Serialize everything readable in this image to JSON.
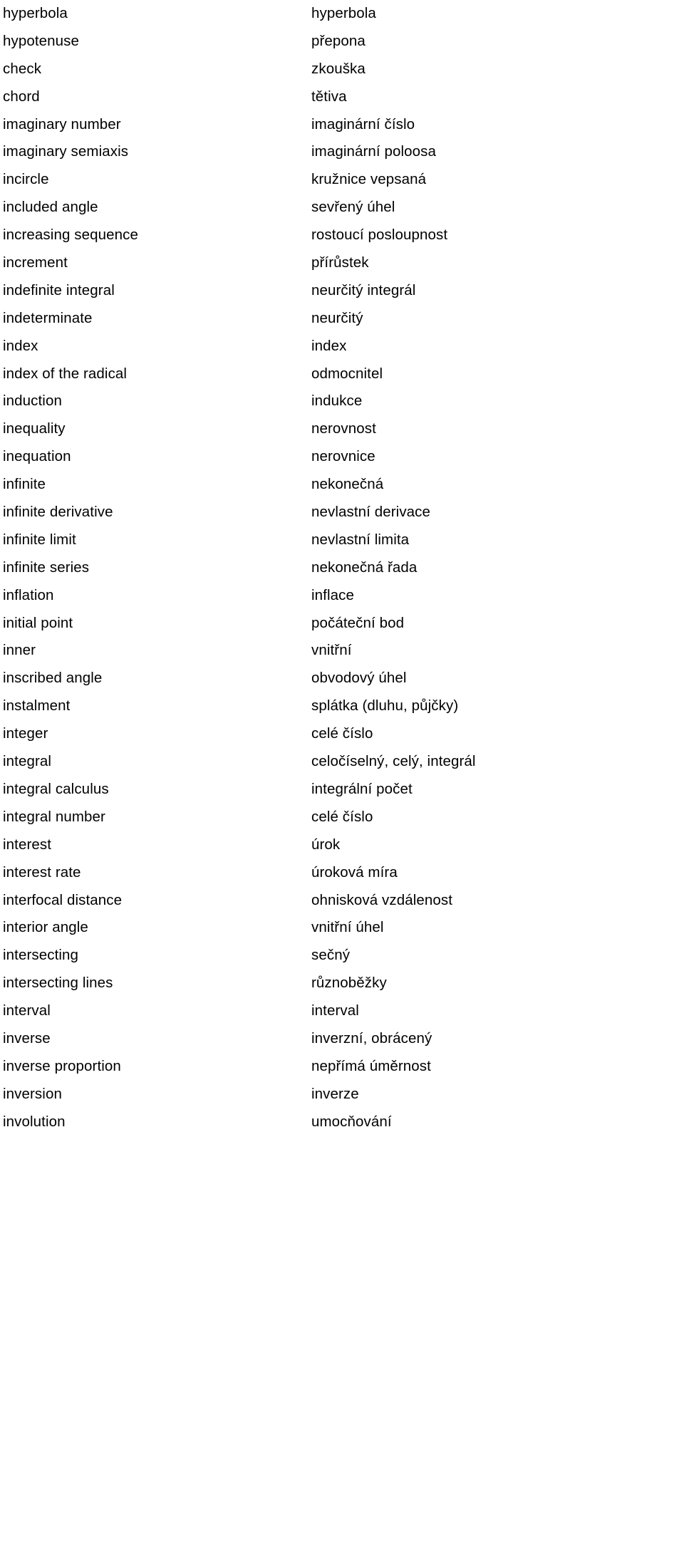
{
  "document": {
    "type": "bilingual-glossary",
    "source_language": "English",
    "target_language": "Czech",
    "columns": [
      "term",
      "translation"
    ],
    "entries": [
      {
        "term": "hyperbola",
        "translation": "hyperbola"
      },
      {
        "term": "hypotenuse",
        "translation": "přepona"
      },
      {
        "term": "check",
        "translation": "zkouška"
      },
      {
        "term": "chord",
        "translation": "tětiva"
      },
      {
        "term": "imaginary number",
        "translation": "imaginární číslo"
      },
      {
        "term": "imaginary semiaxis",
        "translation": "imaginární poloosa"
      },
      {
        "term": "incircle",
        "translation": "kružnice vepsaná"
      },
      {
        "term": "included angle",
        "translation": "sevřený úhel"
      },
      {
        "term": "increasing sequence",
        "translation": "rostoucí posloupnost"
      },
      {
        "term": "increment",
        "translation": "přírůstek"
      },
      {
        "term": "indefinite integral",
        "translation": "neurčitý integrál"
      },
      {
        "term": "indeterminate",
        "translation": "neurčitý"
      },
      {
        "term": "index",
        "translation": "index"
      },
      {
        "term": "index of the radical",
        "translation": "odmocnitel"
      },
      {
        "term": "induction",
        "translation": "indukce"
      },
      {
        "term": "inequality",
        "translation": "nerovnost"
      },
      {
        "term": "inequation",
        "translation": "nerovnice"
      },
      {
        "term": "infinite",
        "translation": "nekonečná"
      },
      {
        "term": "infinite derivative",
        "translation": "nevlastní derivace"
      },
      {
        "term": "infinite limit",
        "translation": "nevlastní limita"
      },
      {
        "term": "infinite series",
        "translation": "nekonečná řada"
      },
      {
        "term": "inflation",
        "translation": "inflace"
      },
      {
        "term": "initial point",
        "translation": "počáteční bod"
      },
      {
        "term": "inner",
        "translation": "vnitřní"
      },
      {
        "term": "inscribed angle",
        "translation": "obvodový úhel"
      },
      {
        "term": "instalment",
        "translation": "splátka (dluhu, půjčky)"
      },
      {
        "term": "integer",
        "translation": "celé číslo"
      },
      {
        "term": "integral",
        "translation": "celočíselný, celý, integrál"
      },
      {
        "term": "integral calculus",
        "translation": "integrální počet"
      },
      {
        "term": "integral number",
        "translation": "celé číslo"
      },
      {
        "term": "interest",
        "translation": "úrok"
      },
      {
        "term": "interest rate",
        "translation": "úroková míra"
      },
      {
        "term": "interfocal distance",
        "translation": "ohnisková vzdálenost"
      },
      {
        "term": "interior angle",
        "translation": "vnitřní úhel"
      },
      {
        "term": "intersecting",
        "translation": "sečný"
      },
      {
        "term": "intersecting lines",
        "translation": "různoběžky"
      },
      {
        "term": "interval",
        "translation": "interval"
      },
      {
        "term": "inverse",
        "translation": "inverzní, obrácený"
      },
      {
        "term": "inverse proportion",
        "translation": "nepřímá úměrnost"
      },
      {
        "term": "inversion",
        "translation": "inverze"
      },
      {
        "term": "involution",
        "translation": "umocňování"
      }
    ]
  }
}
